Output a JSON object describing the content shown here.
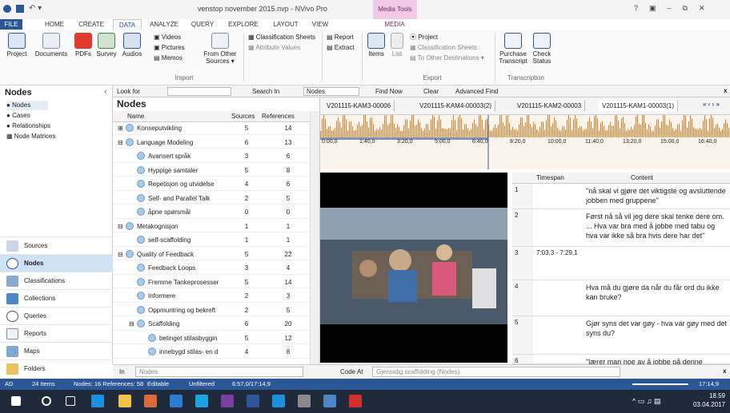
{
  "window": {
    "title": "venstop november 2015.nvp - NVivo Pro",
    "media_tools": "Media Tools",
    "controls": [
      "?",
      "▣",
      "–",
      "⧉",
      "✕"
    ]
  },
  "tabs": [
    "FILE",
    "HOME",
    "CREATE",
    "DATA",
    "ANALYZE",
    "QUERY",
    "EXPLORE",
    "LAYOUT",
    "VIEW",
    "MEDIA"
  ],
  "ribbon": {
    "project": "Project",
    "documents": "Documents",
    "pdfs": "PDFs",
    "survey": "Survey",
    "audios": "Audios",
    "videos": "Videos",
    "pictures": "Pictures",
    "memos": "Memos",
    "from_other": "From Other",
    "sources": "Sources ▾",
    "import_group": "Import",
    "class_sheets": "Classification Sheets",
    "attr_values": "Attribute Values",
    "report": "Report",
    "extract": "Extract",
    "items": "Items",
    "list": "List",
    "proj2": "Project",
    "class_sheets2": "Classification Sheets",
    "to_other": "To Other Destinations ▾",
    "export_group": "Export",
    "purchase": "Purchase",
    "transcript": "Transcript",
    "check": "Check",
    "status": "Status",
    "transcription_group": "Transcription"
  },
  "nav": {
    "title": "Nodes",
    "items": [
      "Nodes",
      "Cases",
      "Relationships",
      "Node Matrices"
    ],
    "big": [
      "Sources",
      "Nodes",
      "Classifications",
      "Collections",
      "Queries",
      "Reports",
      "Maps",
      "Folders"
    ]
  },
  "lookbar": {
    "look_for": "Look for",
    "search_in": "Search In",
    "nodes": "Nodes",
    "find_now": "Find Now",
    "clear": "Clear",
    "advanced": "Advanced Find",
    "close": "x"
  },
  "list": {
    "title": "Nodes",
    "headers": [
      "Name",
      "Sources",
      "References"
    ],
    "rows": [
      {
        "name": "Konseputvikling",
        "s": "5",
        "r": "14",
        "lvl": 0,
        "exp": "⊞"
      },
      {
        "name": "Language Modeling",
        "s": "6",
        "r": "13",
        "lvl": 0,
        "exp": "⊟"
      },
      {
        "name": "Avansert språk",
        "s": "3",
        "r": "6",
        "lvl": 1
      },
      {
        "name": "Hyppige samtaler",
        "s": "5",
        "r": "8",
        "lvl": 1
      },
      {
        "name": "Repetisjon og utvidelse",
        "s": "4",
        "r": "6",
        "lvl": 1
      },
      {
        "name": "Self- and Parallel Talk",
        "s": "2",
        "r": "5",
        "lvl": 1
      },
      {
        "name": "åpne spørsmål",
        "s": "0",
        "r": "0",
        "lvl": 1
      },
      {
        "name": "Metakognisjon",
        "s": "1",
        "r": "1",
        "lvl": 0,
        "exp": "⊟"
      },
      {
        "name": "self-scaffolding",
        "s": "1",
        "r": "1",
        "lvl": 1
      },
      {
        "name": "Quality of Feedback",
        "s": "5",
        "r": "22",
        "lvl": 0,
        "exp": "⊟"
      },
      {
        "name": "Feedback Loops",
        "s": "3",
        "r": "4",
        "lvl": 1
      },
      {
        "name": "Fremme Tankeprosesser",
        "s": "5",
        "r": "14",
        "lvl": 1
      },
      {
        "name": "Informere",
        "s": "2",
        "r": "3",
        "lvl": 1
      },
      {
        "name": "Oppmuntring og bekreft",
        "s": "2",
        "r": "5",
        "lvl": 1
      },
      {
        "name": "Scaffolding",
        "s": "6",
        "r": "20",
        "lvl": 1,
        "exp": "⊟"
      },
      {
        "name": "betinget stilasbyggin",
        "s": "5",
        "r": "12",
        "lvl": 2
      },
      {
        "name": "innebygd stilas- en d",
        "s": "4",
        "r": "8",
        "lvl": 2
      }
    ]
  },
  "media": {
    "tabs": [
      "V201115-KAM3-00006",
      "V201115-KAM4-00003(2)",
      "V201115-KAM2-00003",
      "V201115-KAM1-00003(1)"
    ],
    "ticks": [
      "0:00,0",
      "1:40,0",
      "3:20,0",
      "5:00,0",
      "6:40,0",
      "8:20,0",
      "10:00,0",
      "11:40,0",
      "13:20,0",
      "15:00,0",
      "16:40,0"
    ],
    "col_timespan": "Timespan",
    "col_content": "Content",
    "rows": [
      {
        "n": "1",
        "t": "",
        "c": "\"nå skal vi gjøre det viktigste og avsluttende jobben med gruppene\""
      },
      {
        "n": "2",
        "t": "",
        "c": "Først nå så vil jeg dere skal tenke dere om. ... Hva var bra med å jobbe med tabu og hva var ikke så bra hvis dere har det\""
      },
      {
        "n": "3",
        "t": "7:03,3 - 7:29,1",
        "c": ""
      },
      {
        "n": "4",
        "t": "",
        "c": "Hva må du gjøre da når du får ord du ikke kan bruke?"
      },
      {
        "n": "5",
        "t": "",
        "c": "Gjør syns det var gøy - hva var gøy med det syns du?"
      },
      {
        "n": "6",
        "t": "",
        "c": "\"lærer man noe av å jobbe på denne"
      }
    ]
  },
  "bottom": {
    "in": "In",
    "nodes": "Nodes",
    "code_at": "Code At",
    "code_value": "Gjensidig scaffolding (Nodes)",
    "close": "x"
  },
  "status": {
    "user": "AD",
    "items": "24 Items",
    "nodes": "Nodes: 16 References: 58",
    "editable": "Editable",
    "unfiltered": "Unfiltered",
    "time": "6:57,0/17:14,9",
    "zoom": "17:14,9"
  },
  "taskbar": {
    "time": "18.59",
    "date": "03.04.2017"
  },
  "colors": {
    "accent": "#2b5797",
    "nodes_sel": "#cfe1f5",
    "wave": "#d9822b"
  }
}
